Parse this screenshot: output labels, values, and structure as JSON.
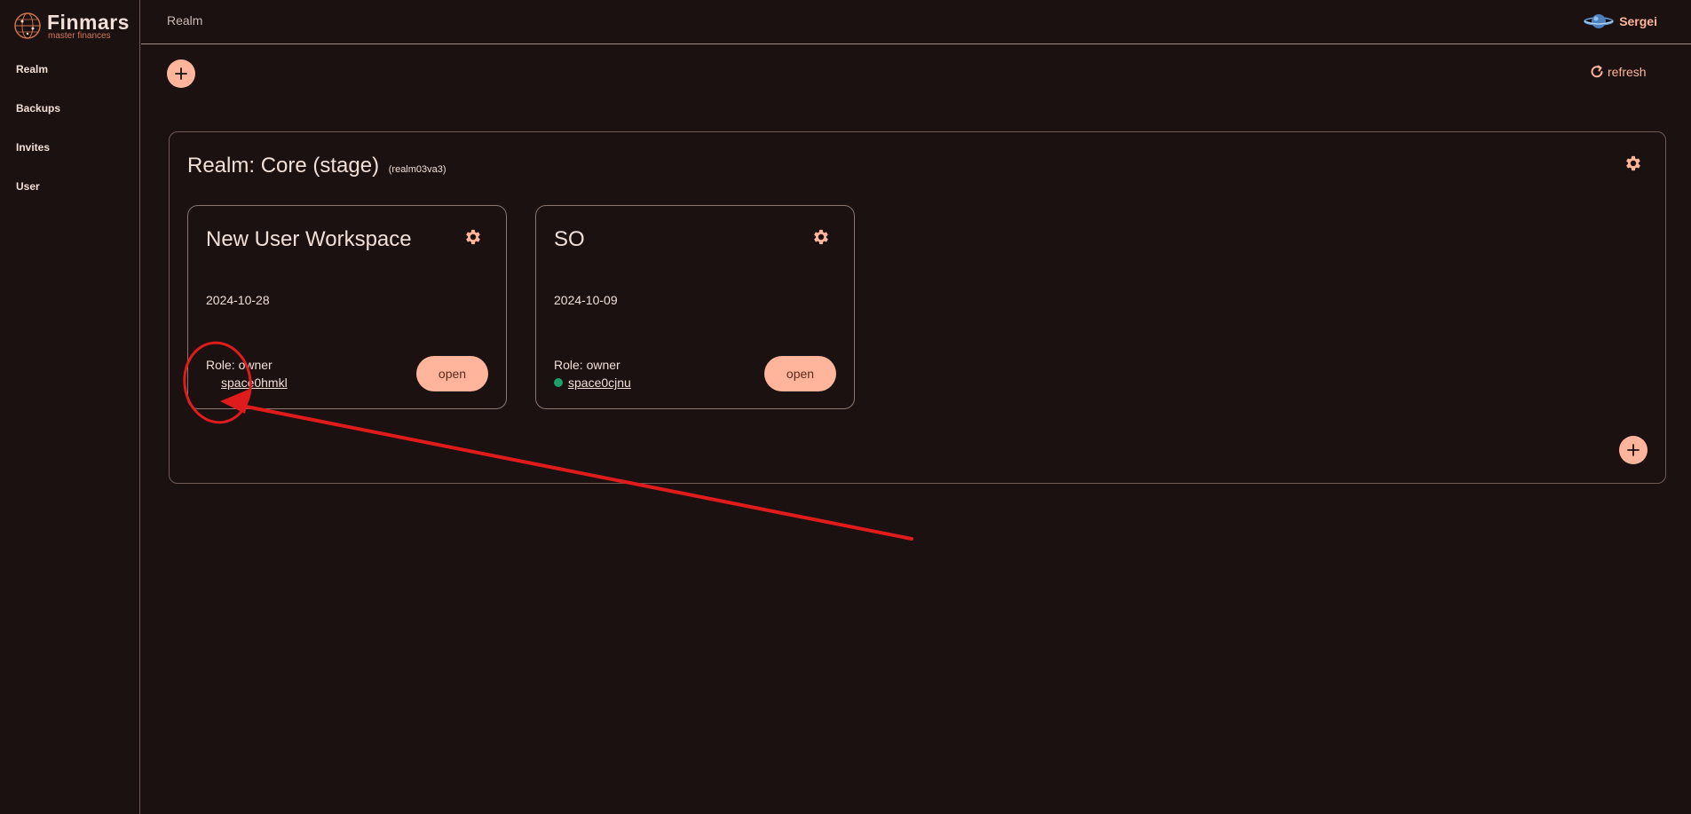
{
  "app": {
    "logo_text": "Finmars",
    "logo_subtitle": "master finances"
  },
  "sidebar": {
    "items": [
      {
        "label": "Realm"
      },
      {
        "label": "Backups"
      },
      {
        "label": "Invites"
      },
      {
        "label": "User"
      }
    ]
  },
  "header": {
    "title": "Realm",
    "user_name": "Sergei"
  },
  "toolbar": {
    "refresh_label": "refresh"
  },
  "realm": {
    "title": "Realm: Core (stage)",
    "id": "(realm03va3)",
    "workspaces": [
      {
        "name": "New User Workspace",
        "date": "2024-10-28",
        "role": "Role: owner",
        "space": "space0hmkl",
        "status": "none",
        "open_label": "open"
      },
      {
        "name": "SO",
        "date": "2024-10-09",
        "role": "Role: owner",
        "space": "space0cjnu",
        "status": "online",
        "open_label": "open"
      }
    ]
  },
  "colors": {
    "background": "#1a1110",
    "accent": "#ffb59b",
    "status_online": "#1e9e6a",
    "annotation": "#e01b1b"
  },
  "icons": {
    "add": "plus-icon",
    "settings": "gear-icon",
    "refresh": "refresh-icon",
    "avatar": "planet-avatar-icon"
  }
}
